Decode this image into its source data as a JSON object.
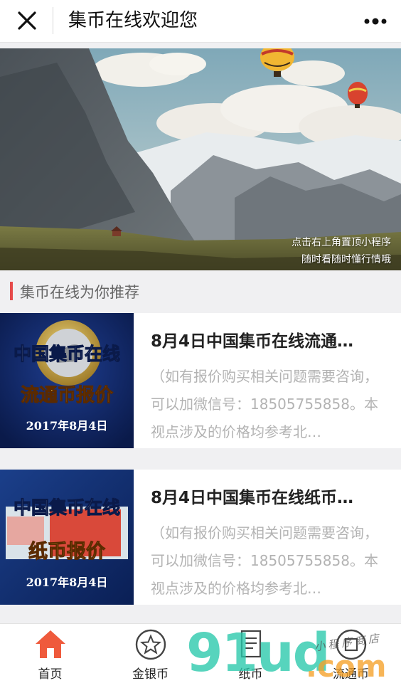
{
  "header": {
    "title": "集币在线欢迎您",
    "close_icon": "close-icon",
    "more_icon": "more-icon"
  },
  "banner": {
    "caption_line1": "点击右上角置顶小程序",
    "caption_line2": "随时看随时懂行情哦"
  },
  "section": {
    "title": "集币在线为你推荐",
    "accent_color": "#e64b4b"
  },
  "articles": [
    {
      "title": "8月4日中国集币在线流通…",
      "desc": "（如有报价购买相关问题需要咨询，可以加微信号：18505755858。本视点涉及的价格均参考北…",
      "thumb": {
        "line1": "中国集币在线",
        "line2": "流通币报价",
        "date": "2017年8月4日"
      }
    },
    {
      "title": "8月4日中国集币在线纸币…",
      "desc": "（如有报价购买相关问题需要咨询，可以加微信号：18505755858。本视点涉及的价格均参考北…",
      "thumb": {
        "line1": "中国集币在线",
        "line2": "纸币报价",
        "date": "2017年8月4日"
      }
    }
  ],
  "tabs": [
    {
      "label": "首页",
      "icon": "home-icon",
      "active": true
    },
    {
      "label": "金银币",
      "icon": "star-coin-icon",
      "active": false
    },
    {
      "label": "纸币",
      "icon": "banknote-icon",
      "active": false
    },
    {
      "label": "流通币",
      "icon": "coin-icon",
      "active": false
    }
  ],
  "watermark": {
    "main": "91ud",
    "suffix": ".com",
    "handwriting": "小程序商店"
  },
  "colors": {
    "accent": "#e64b4b",
    "watermark_green": "#28c8aa",
    "watermark_orange": "#f5a028"
  }
}
